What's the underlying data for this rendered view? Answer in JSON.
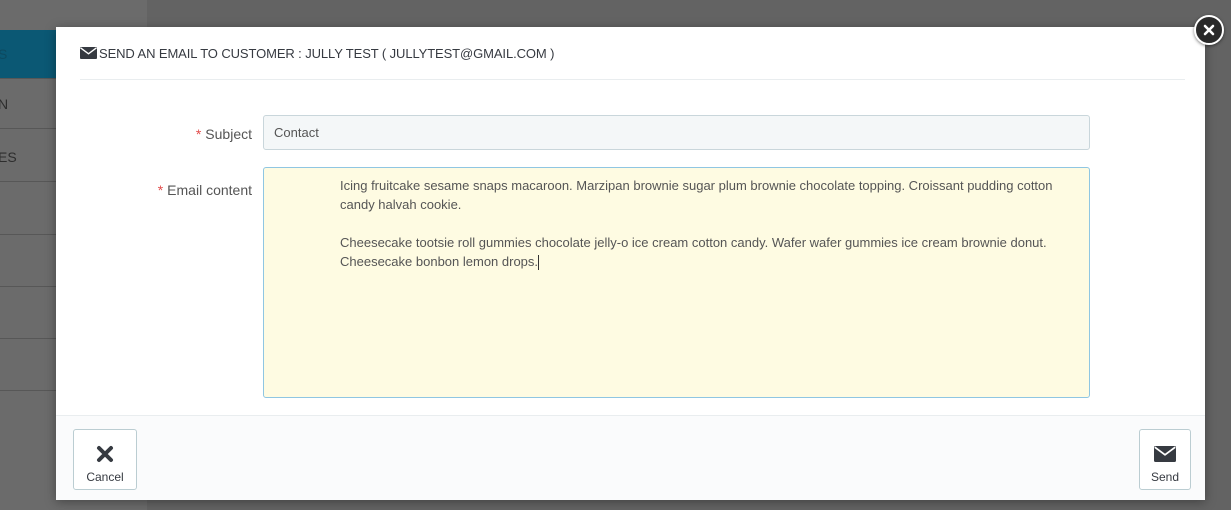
{
  "background": {
    "sidebar_items": [
      {
        "label": "S",
        "active": true
      },
      {
        "label": "N",
        "active": false
      },
      {
        "label": "ES",
        "active": false
      },
      {
        "label": "",
        "active": false
      },
      {
        "label": "",
        "active": false
      },
      {
        "label": "",
        "active": false
      },
      {
        "label": "",
        "active": false
      }
    ]
  },
  "modal": {
    "title": "SEND AN EMAIL TO CUSTOMER : JULLY TEST ( JULLYTEST@GMAIL.COM )",
    "close_icon": "close-icon",
    "subject": {
      "required_mark": "*",
      "label": "Subject",
      "value": "Contact"
    },
    "content": {
      "required_mark": "*",
      "label": "Email content",
      "paragraph_1": "Icing fruitcake sesame snaps macaroon. Marzipan brownie sugar plum brownie chocolate topping. Croissant pudding cotton candy halvah cookie.",
      "paragraph_2": "Cheesecake tootsie roll gummies chocolate jelly-o ice cream cotton candy. Wafer wafer gummies ice cream brownie donut. Cheesecake bonbon lemon drops."
    },
    "footer": {
      "cancel_label": "Cancel",
      "send_label": "Send"
    }
  },
  "colors": {
    "required": "#e24c4b",
    "content_bg": "#fefbe2",
    "content_border": "#8fc6e2",
    "active_sidebar": "#0b5874"
  }
}
